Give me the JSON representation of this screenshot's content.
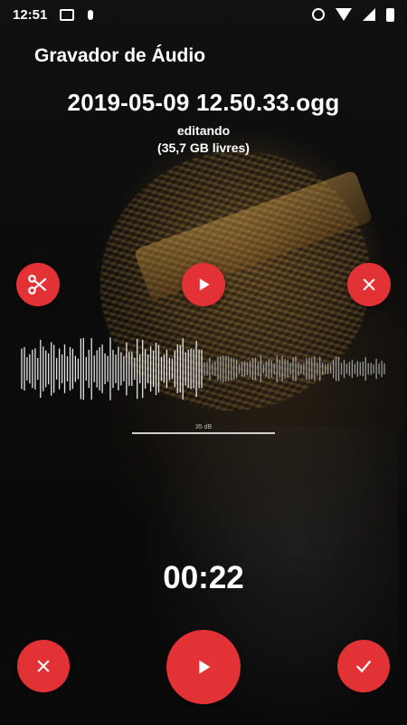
{
  "status_bar": {
    "time": "12:51",
    "icons_left": [
      "cast-icon",
      "mic-icon"
    ],
    "icons_right": [
      "dnd-icon",
      "wifi-icon",
      "signal-icon",
      "battery-icon"
    ]
  },
  "app": {
    "title": "Gravador de Áudio"
  },
  "recording": {
    "file_name": "2019-05-09 12.50.33.ogg",
    "state": "editando",
    "free_space": "(35,7 GB livres)",
    "elapsed": "00:22"
  },
  "meter": {
    "label": "35 dB"
  },
  "colors": {
    "accent": "#e23236",
    "text": "#ffffff"
  },
  "icons": {
    "trim": "scissors-icon",
    "preview_play": "play-icon",
    "discard_top": "close-icon",
    "discard_bottom": "close-icon",
    "play_main": "play-icon",
    "confirm": "check-icon"
  }
}
